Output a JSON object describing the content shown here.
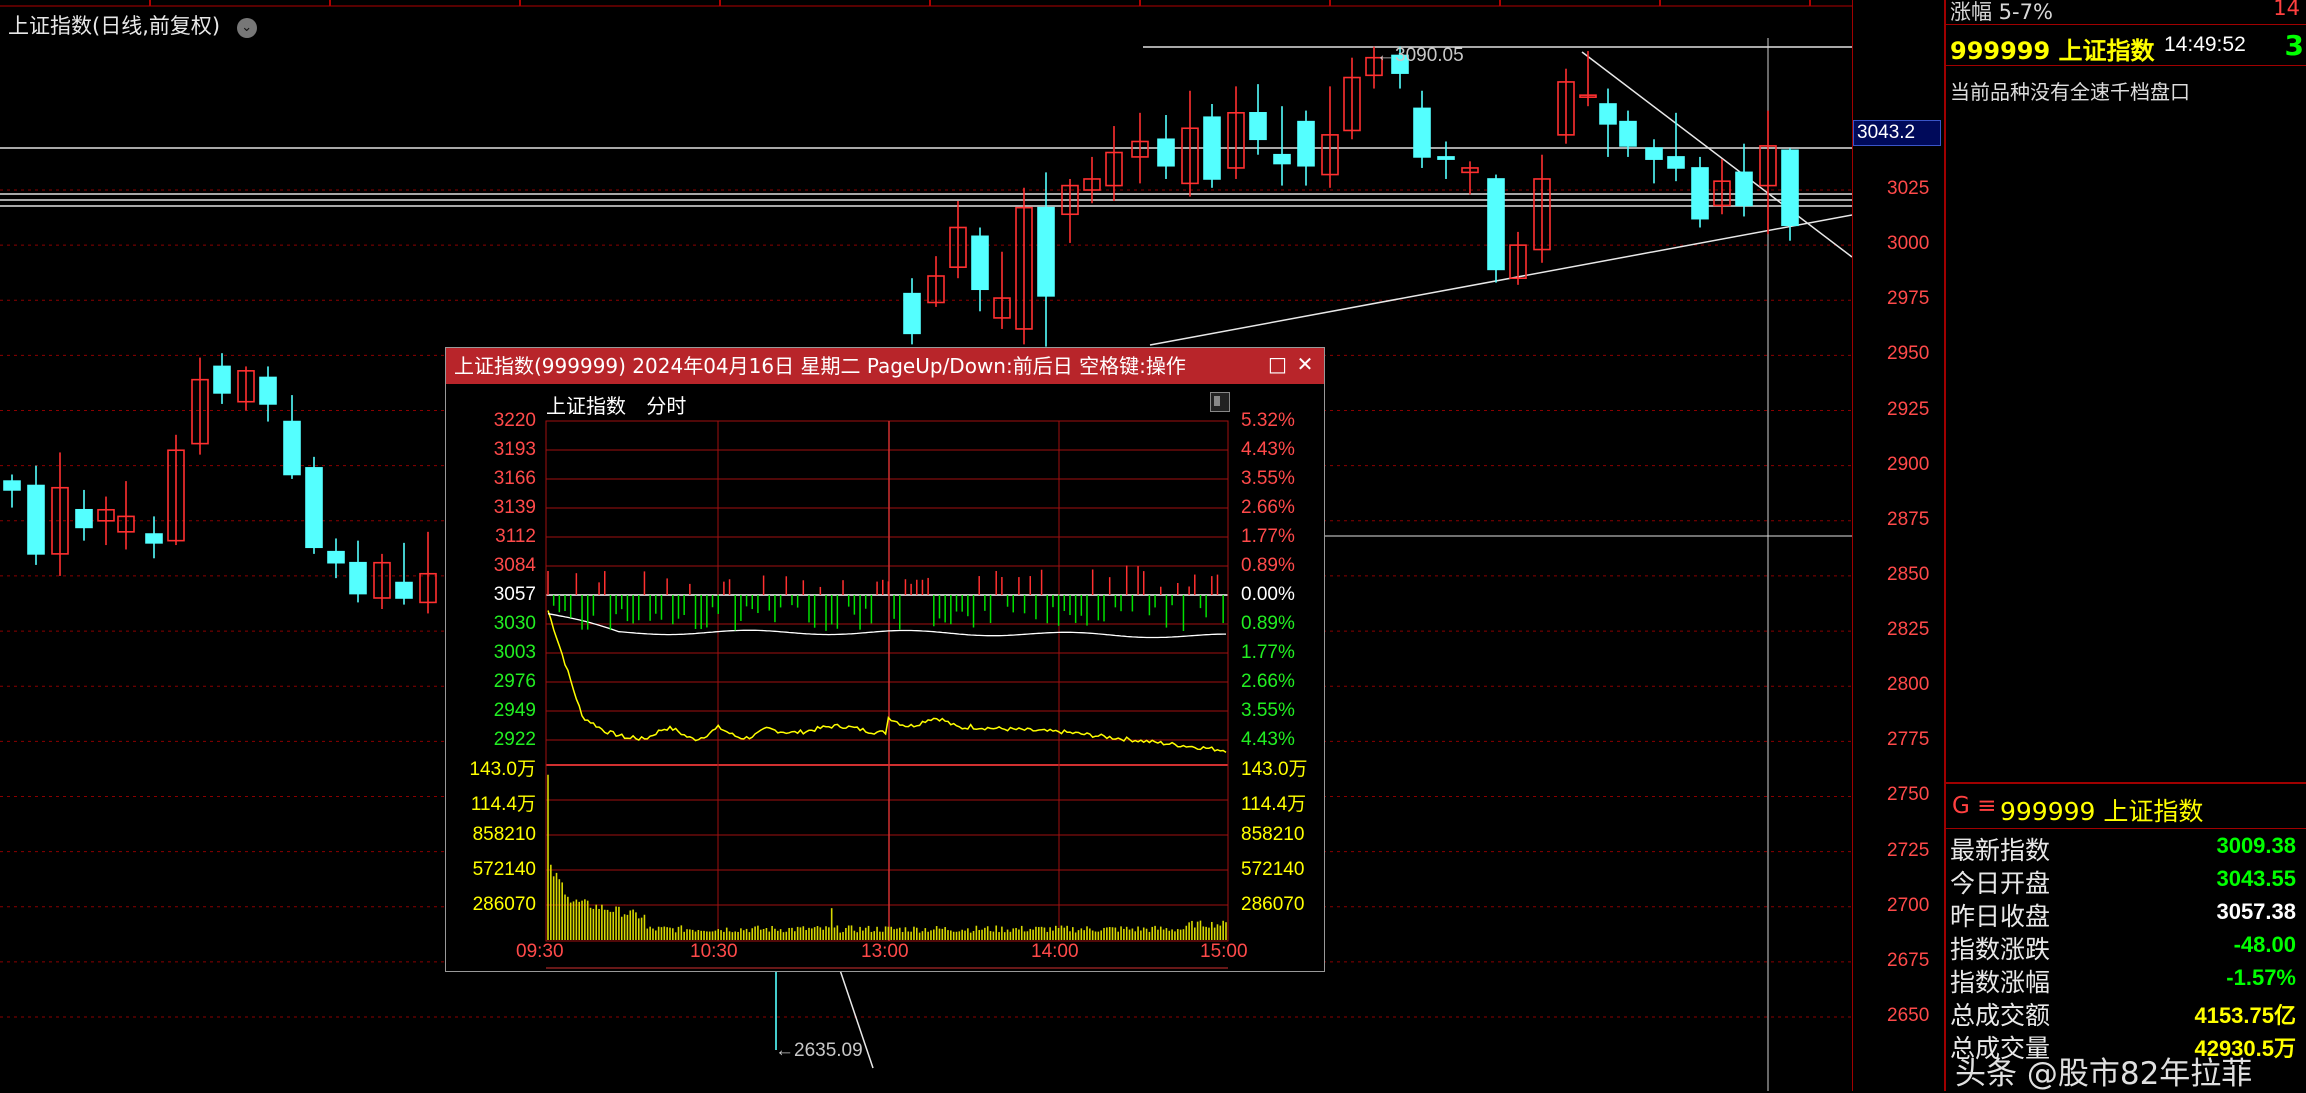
{
  "main_chart": {
    "title": "上证指数(日线,前复权)",
    "dropdown_glyph": "⌄",
    "high_marker": "3090.05",
    "low_marker": "2635.09",
    "crosshair_value": "3043.2",
    "price_ticks": [
      "3025",
      "3000",
      "2975",
      "2950",
      "2925",
      "2900",
      "2875",
      "2850",
      "2825",
      "2800",
      "2775",
      "2750",
      "2725",
      "2700",
      "2675",
      "2650"
    ],
    "colors": {
      "up": "#ff3030",
      "down": "#54ffff",
      "grid": "#8b0000",
      "axis_text": "#ff4a4a"
    }
  },
  "side_panel": {
    "top_label": "涨幅 5-7%",
    "top_value": "14",
    "code_title": "999999 上证指数",
    "time": "14:49:52",
    "badge": "3",
    "note": "当前品种没有全速千档盘口",
    "quote_header_icon": "G ≡",
    "quote_header_title": "999999 上证指数",
    "quotes": [
      {
        "label": "最新指数",
        "value": "3009.38",
        "color": "#00ff00"
      },
      {
        "label": "今日开盘",
        "value": "3043.55",
        "color": "#00ff00"
      },
      {
        "label": "昨日收盘",
        "value": "3057.38",
        "color": "#ffffff"
      },
      {
        "label": "指数涨跌",
        "value": "-48.00",
        "color": "#00ff00"
      },
      {
        "label": "指数涨幅",
        "value": "-1.57%",
        "color": "#00ff00"
      },
      {
        "label": "总成交额",
        "value": "4153.75亿",
        "color": "#ffff00"
      },
      {
        "label": "总成交量",
        "value": "42930.5万",
        "color": "#ffff00"
      }
    ]
  },
  "watermark": "头条 @股市82年拉菲",
  "popup": {
    "title": "上证指数(999999) 2024年04月16日 星期二 PageUp/Down:前后日 空格键:操作",
    "restore_glyph": "□",
    "close_glyph": "✕",
    "header_name": "上证指数",
    "header_mode": "分时",
    "price_left": [
      "3220",
      "3193",
      "3166",
      "3139",
      "3112",
      "3084",
      "3057",
      "3030",
      "3003",
      "2976",
      "2949",
      "2922"
    ],
    "price_right": [
      "5.32%",
      "4.43%",
      "3.55%",
      "2.66%",
      "1.77%",
      "0.89%",
      "0.00%",
      "0.89%",
      "1.77%",
      "2.66%",
      "3.55%",
      "4.43%"
    ],
    "vol_left": [
      "143.0万",
      "114.4万",
      "858210",
      "572140",
      "286070"
    ],
    "vol_right": [
      "143.0万",
      "114.4万",
      "858210",
      "572140",
      "286070"
    ],
    "times": [
      "09:30",
      "10:30",
      "13:00",
      "14:00",
      "15:00"
    ],
    "colors": {
      "price_line": "#ffff00",
      "avg_line": "#ffffff",
      "volume": "#d8d800",
      "up_bar": "#ff3030",
      "down_bar": "#00e000",
      "grid": "#a01010"
    }
  }
}
